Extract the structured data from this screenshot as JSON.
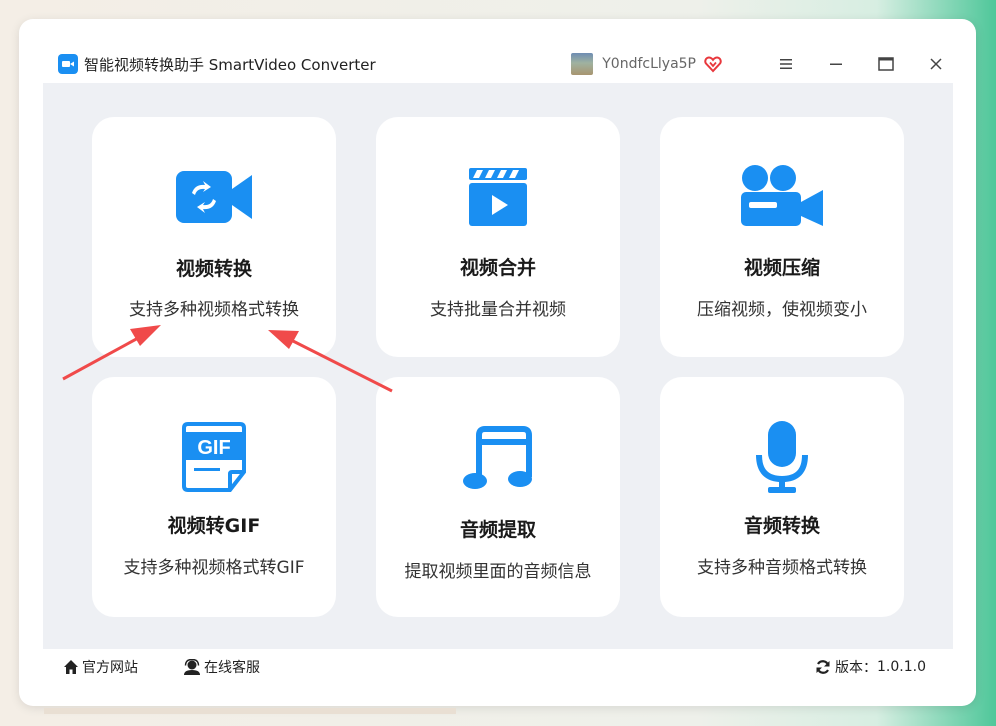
{
  "window": {
    "title": "智能视频转换助手 SmartVideo Converter",
    "logo_icon": "video-app-logo-icon"
  },
  "user": {
    "name": "Y0ndfcLlya5P",
    "vip_icon": "heart-diamond-vip-icon"
  },
  "window_controls": [
    "menu-icon",
    "minimize-icon",
    "maximize-icon",
    "close-icon"
  ],
  "colors": {
    "accent": "#1a8ff2",
    "vip": "#e8383d",
    "annotation_arrow": "#f04a4a",
    "content_bg": "#eef0f4"
  },
  "cards": [
    {
      "title": "视频转换",
      "desc": "支持多种视频格式转换",
      "icon": "video-convert-icon"
    },
    {
      "title": "视频合并",
      "desc": "支持批量合并视频",
      "icon": "clapperboard-play-icon"
    },
    {
      "title": "视频压缩",
      "desc": "压缩视频，使视频变小",
      "icon": "movie-camera-icon"
    },
    {
      "title": "视频转GIF",
      "desc": "支持多种视频格式转GIF",
      "icon": "gif-file-icon"
    },
    {
      "title": "音频提取",
      "desc": "提取视频里面的音频信息",
      "icon": "music-note-icon"
    },
    {
      "title": "音频转换",
      "desc": "支持多种音频格式转换",
      "icon": "microphone-icon"
    }
  ],
  "footer": {
    "website": "官方网站",
    "support": "在线客服",
    "version_label": "版本：",
    "version_value": "1.0.1.0"
  }
}
